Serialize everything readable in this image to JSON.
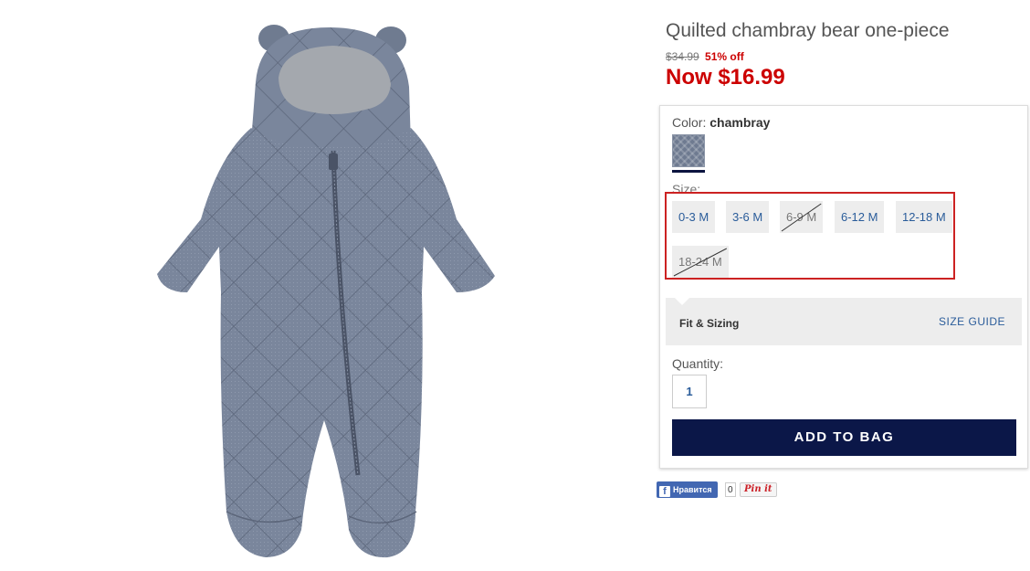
{
  "product": {
    "title": "Quilted chambray bear one-piece",
    "original_price": "$34.99",
    "discount": "51% off",
    "now_price": "Now $16.99",
    "image_icon": "bear-one-piece-photo"
  },
  "color": {
    "label": "Color:",
    "value": "chambray",
    "swatch_color": "#6e7a90"
  },
  "size": {
    "label": "Size:",
    "options": [
      {
        "label": "0-3 M",
        "available": true
      },
      {
        "label": "3-6 M",
        "available": true
      },
      {
        "label": "6-9 M",
        "available": false
      },
      {
        "label": "6-12 M",
        "available": true
      },
      {
        "label": "12-18 M",
        "available": true
      },
      {
        "label": "18-24 M",
        "available": false
      }
    ],
    "highlight_color": "#cc2222"
  },
  "fit": {
    "label": "Fit & Sizing",
    "size_guide": "SIZE GUIDE"
  },
  "quantity": {
    "label": "Quantity:",
    "value": "1"
  },
  "add_to_bag": "ADD TO BAG",
  "social": {
    "facebook_like": "Нравится",
    "facebook_count": "0",
    "pinterest": "Pin it"
  },
  "colors": {
    "accent": "#0b1748",
    "sale": "#cc0000",
    "link": "#2a5c9a"
  }
}
